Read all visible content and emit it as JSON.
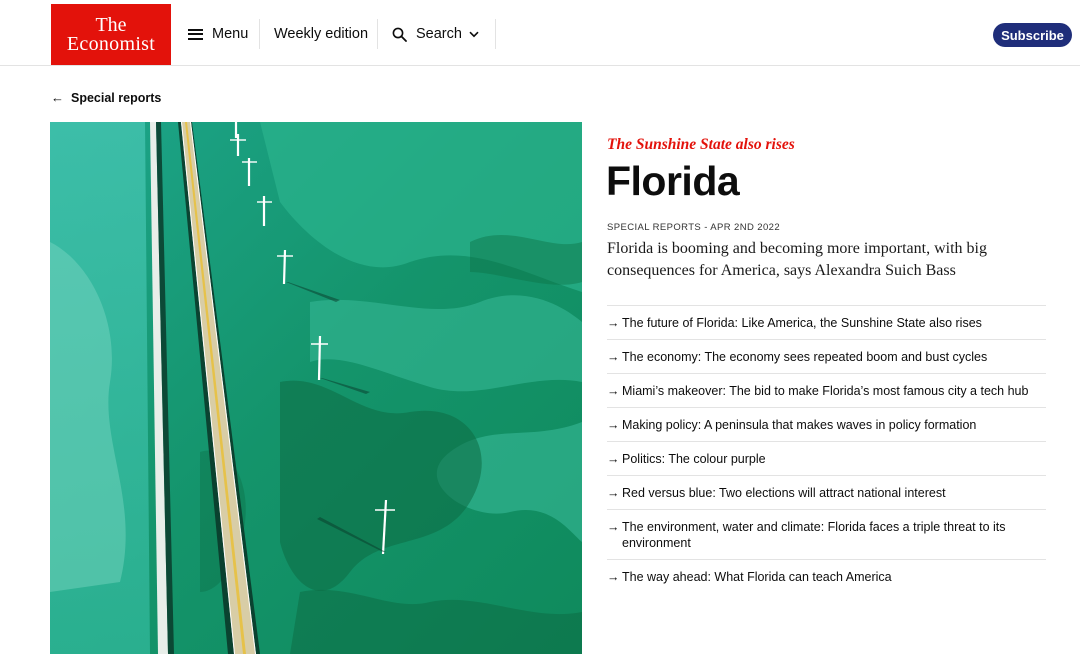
{
  "header": {
    "logo": {
      "line1": "The",
      "line2": "Economist"
    },
    "menu_label": "Menu",
    "weekly_label": "Weekly edition",
    "search_label": "Search",
    "subscribe_label": "Subscribe"
  },
  "back_link": {
    "label": "Special reports"
  },
  "article": {
    "fly_title": "The Sunshine State also rises",
    "title": "Florida",
    "meta": "SPECIAL REPORTS - APR 2ND 2022",
    "description": "Florida is booming and becoming more important, with big consequences for America, says Alexandra Suich Bass"
  },
  "chapters": [
    {
      "label": "The future of Florida: Like America, the Sunshine State also rises"
    },
    {
      "label": "The economy: The economy sees repeated boom and bust cycles"
    },
    {
      "label": "Miami’s makeover: The bid to make Florida’s most famous city a tech hub"
    },
    {
      "label": "Making policy: A peninsula that makes waves in policy formation"
    },
    {
      "label": "Politics: The colour purple"
    },
    {
      "label": "Red versus blue: Two elections will attract national interest"
    },
    {
      "label": "The environment, water and climate: Florida faces a triple threat to its environment"
    },
    {
      "label": "The way ahead: What Florida can teach America"
    }
  ],
  "icons": {
    "menu": "hamburger-icon",
    "search": "search-icon",
    "chevron": "chevron-down-icon",
    "back": "arrow-left-icon",
    "chapter_arrow": "arrow-right-icon"
  },
  "colors": {
    "brand_red": "#e3120b",
    "subscribe_blue": "#1f2e7a"
  }
}
